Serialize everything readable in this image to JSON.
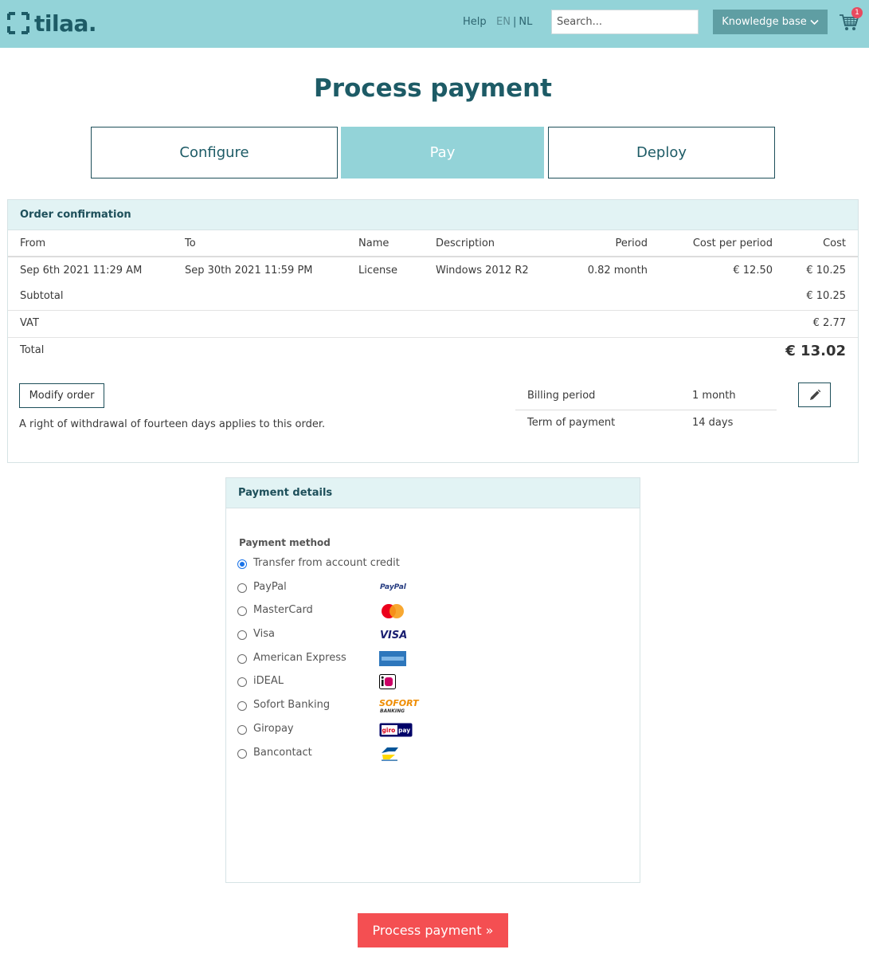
{
  "header": {
    "logo_text": "tilaa.",
    "help": "Help",
    "lang_en": "EN",
    "lang_sep": "|",
    "lang_nl": "NL",
    "search_placeholder": "Search...",
    "kb_label": "Knowledge base",
    "cart_count": "1"
  },
  "page": {
    "title": "Process payment"
  },
  "steps": {
    "configure": "Configure",
    "pay": "Pay",
    "deploy": "Deploy"
  },
  "order": {
    "panel_title": "Order confirmation",
    "columns": {
      "from": "From",
      "to": "To",
      "name": "Name",
      "description": "Description",
      "period": "Period",
      "cost_per_period": "Cost per period",
      "cost": "Cost"
    },
    "line": {
      "from": "Sep 6th 2021 11:29 AM",
      "to": "Sep 30th 2021 11:59 PM",
      "name": "License",
      "description": "Windows 2012 R2",
      "period": "0.82 month",
      "cost_per_period": "€ 12.50",
      "cost": "€ 10.25"
    },
    "subtotal_label": "Subtotal",
    "subtotal_value": "€ 10.25",
    "vat_label": "VAT",
    "vat_value": "€ 2.77",
    "total_label": "Total",
    "total_value": "€ 13.02",
    "modify_label": "Modify order",
    "withdrawal_text": "A right of withdrawal of fourteen days applies to this order.",
    "billing_period_label": "Billing period",
    "billing_period_value": "1 month",
    "term_label": "Term of payment",
    "term_value": "14 days"
  },
  "payment": {
    "panel_title": "Payment details",
    "method_label": "Payment method",
    "methods": [
      {
        "label": "Transfer from account credit",
        "selected": true,
        "logo": ""
      },
      {
        "label": "PayPal",
        "selected": false,
        "logo": "paypal-logo"
      },
      {
        "label": "MasterCard",
        "selected": false,
        "logo": "mastercard-logo"
      },
      {
        "label": "Visa",
        "selected": false,
        "logo": "visa-logo"
      },
      {
        "label": "American Express",
        "selected": false,
        "logo": "amex-logo"
      },
      {
        "label": "iDEAL",
        "selected": false,
        "logo": "ideal-logo"
      },
      {
        "label": "Sofort Banking",
        "selected": false,
        "logo": "sofort-logo"
      },
      {
        "label": "Giropay",
        "selected": false,
        "logo": "giropay-logo"
      },
      {
        "label": "Bancontact",
        "selected": false,
        "logo": "bancontact-logo"
      }
    ],
    "logo_text": {
      "paypal": "PayPal",
      "visa": "VISA",
      "sofort": "SOFORT",
      "sofort_sub": "BANKING",
      "giro_a": "giro",
      "giro_b": "pay"
    }
  },
  "actions": {
    "process_label": "Process payment »"
  },
  "colors": {
    "header_bg": "#93d3d8",
    "brand_dark": "#1d5b66",
    "panel_head": "#e2f3f4",
    "cta": "#f44f52",
    "kb_button": "#5f9ea3"
  }
}
